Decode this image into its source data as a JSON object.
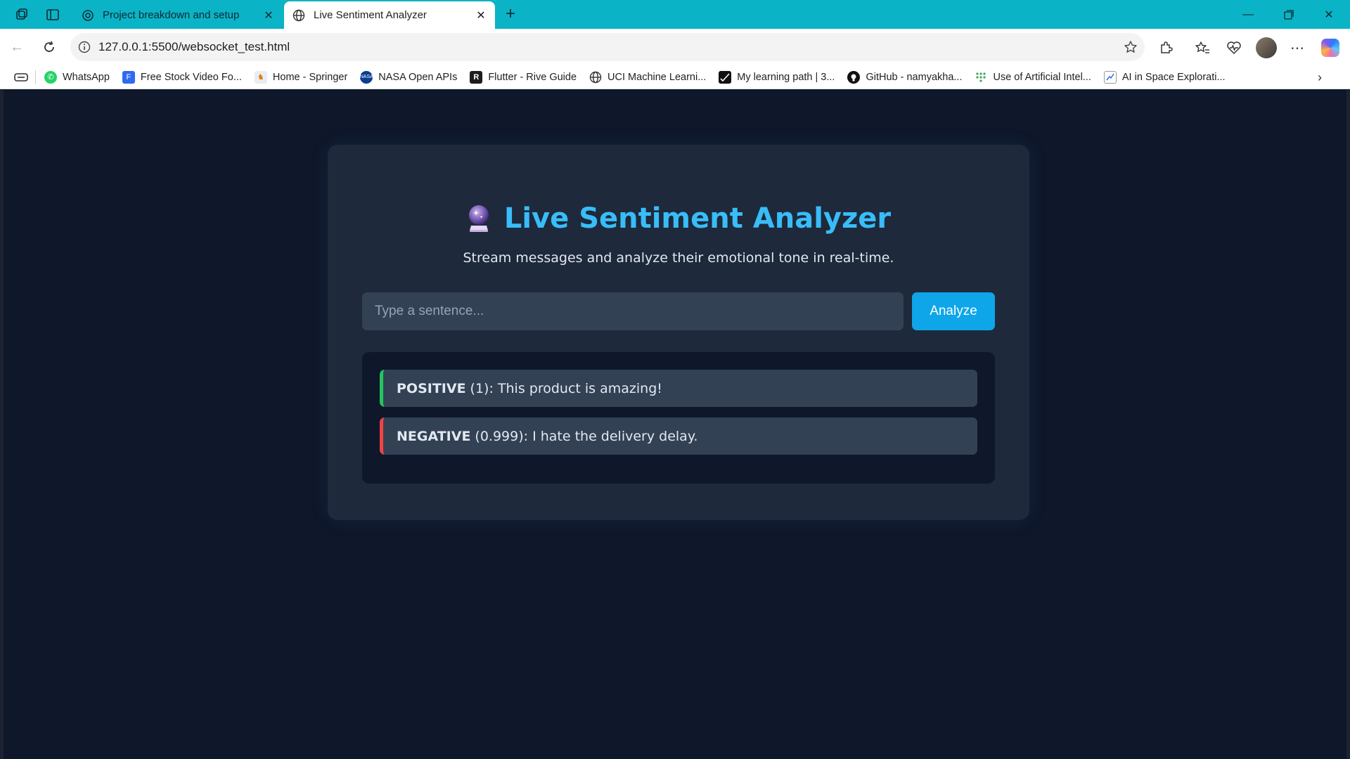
{
  "browser": {
    "tabs": [
      {
        "title": "Project breakdown and setup",
        "active": false,
        "icon": "chatgpt-icon"
      },
      {
        "title": "Live Sentiment Analyzer",
        "active": true,
        "icon": "globe-icon"
      }
    ],
    "url": "127.0.0.1:5500/websocket_test.html",
    "bookmarks": [
      {
        "label": "WhatsApp",
        "icon": "whatsapp-icon",
        "color": "#25d366"
      },
      {
        "label": "Free Stock Video Fo...",
        "icon": "bookmark-f-icon",
        "color": "#2f6bf0"
      },
      {
        "label": "Home - Springer",
        "icon": "springer-icon",
        "color": "#e8edf5"
      },
      {
        "label": "NASA Open APIs",
        "icon": "nasa-icon",
        "color": "#0b3d91"
      },
      {
        "label": "Flutter - Rive Guide",
        "icon": "rive-icon",
        "color": "#1d1d1d"
      },
      {
        "label": "UCI Machine Learni...",
        "icon": "globe-icon",
        "color": "#ffffff"
      },
      {
        "label": "My learning path | 3...",
        "icon": "learning-icon",
        "color": "#111111"
      },
      {
        "label": "GitHub - namyakha...",
        "icon": "github-icon",
        "color": "#111111"
      },
      {
        "label": "Use of Artificial Intel...",
        "icon": "grid-dots-icon",
        "color": "#3aa655"
      },
      {
        "label": "AI in Space Explorati...",
        "icon": "chart-doc-icon",
        "color": "#ffffff"
      }
    ]
  },
  "app": {
    "title": "Live Sentiment Analyzer",
    "title_icon": "crystal-ball-icon",
    "subtitle": "Stream messages and analyze their emotional tone in real-time.",
    "input": {
      "placeholder": "Type a sentence...",
      "value": ""
    },
    "analyze_label": "Analyze",
    "accent_color": "#38bdf8",
    "results": [
      {
        "label": "POSITIVE",
        "score": "(1): This product is amazing!",
        "color": "#22c55e"
      },
      {
        "label": "NEGATIVE",
        "score": "(0.999): I hate the delivery delay.",
        "color": "#ef4444"
      }
    ]
  }
}
